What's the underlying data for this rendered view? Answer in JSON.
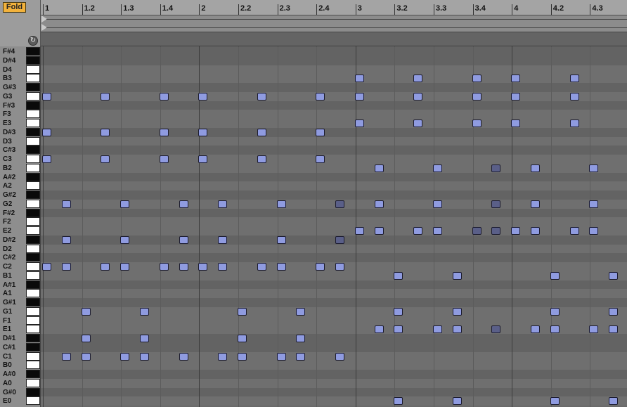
{
  "toolbar": {
    "fold_label": "Fold",
    "reset_icon": "refresh-icon"
  },
  "ruler": {
    "labels": [
      "1",
      "1.2",
      "1.3",
      "1.4",
      "2",
      "2.2",
      "2.3",
      "2.4",
      "3",
      "3.2",
      "3.3",
      "3.4",
      "4",
      "4.2",
      "4.3"
    ]
  },
  "piano": {
    "rows": [
      {
        "label": "F#4",
        "black": true
      },
      {
        "label": "D#4",
        "black": true
      },
      {
        "label": "D4",
        "black": false
      },
      {
        "label": "B3",
        "black": false
      },
      {
        "label": "G#3",
        "black": true
      },
      {
        "label": "G3",
        "black": false
      },
      {
        "label": "F#3",
        "black": true
      },
      {
        "label": "F3",
        "black": false
      },
      {
        "label": "E3",
        "black": false
      },
      {
        "label": "D#3",
        "black": true
      },
      {
        "label": "D3",
        "black": false
      },
      {
        "label": "C#3",
        "black": true
      },
      {
        "label": "C3",
        "black": false
      },
      {
        "label": "B2",
        "black": false
      },
      {
        "label": "A#2",
        "black": true
      },
      {
        "label": "A2",
        "black": false
      },
      {
        "label": "G#2",
        "black": true
      },
      {
        "label": "G2",
        "black": false
      },
      {
        "label": "F#2",
        "black": true
      },
      {
        "label": "F2",
        "black": false
      },
      {
        "label": "E2",
        "black": false
      },
      {
        "label": "D#2",
        "black": true
      },
      {
        "label": "D2",
        "black": false
      },
      {
        "label": "C#2",
        "black": true
      },
      {
        "label": "C2",
        "black": false
      },
      {
        "label": "B1",
        "black": false
      },
      {
        "label": "A#1",
        "black": true
      },
      {
        "label": "A1",
        "black": false
      },
      {
        "label": "G#1",
        "black": true
      },
      {
        "label": "G1",
        "black": false
      },
      {
        "label": "F1",
        "black": false
      },
      {
        "label": "E1",
        "black": false
      },
      {
        "label": "D#1",
        "black": true
      },
      {
        "label": "C#1",
        "black": true
      },
      {
        "label": "C1",
        "black": false
      },
      {
        "label": "B0",
        "black": false
      },
      {
        "label": "A#0",
        "black": true
      },
      {
        "label": "A0",
        "black": false
      },
      {
        "label": "G#0",
        "black": true
      },
      {
        "label": "E0",
        "black": false
      }
    ]
  },
  "clip": {
    "colors": {
      "selected": "#8f9be0",
      "unselected": "#5a5f88",
      "border": "#1c1c30"
    },
    "notes": [
      {
        "pitch": "G3",
        "start": 1.0,
        "sel": true
      },
      {
        "pitch": "D#3",
        "start": 1.0,
        "sel": true
      },
      {
        "pitch": "C3",
        "start": 1.0,
        "sel": true
      },
      {
        "pitch": "G3",
        "start": 1.375,
        "sel": true
      },
      {
        "pitch": "D#3",
        "start": 1.375,
        "sel": true
      },
      {
        "pitch": "C3",
        "start": 1.375,
        "sel": true
      },
      {
        "pitch": "G3",
        "start": 1.75,
        "sel": true
      },
      {
        "pitch": "D#3",
        "start": 1.75,
        "sel": true
      },
      {
        "pitch": "C3",
        "start": 1.75,
        "sel": true
      },
      {
        "pitch": "G3",
        "start": 2.0,
        "sel": true
      },
      {
        "pitch": "D#3",
        "start": 2.0,
        "sel": true
      },
      {
        "pitch": "C3",
        "start": 2.0,
        "sel": true
      },
      {
        "pitch": "G3",
        "start": 2.375,
        "sel": true
      },
      {
        "pitch": "D#3",
        "start": 2.375,
        "sel": true
      },
      {
        "pitch": "C3",
        "start": 2.375,
        "sel": true
      },
      {
        "pitch": "G3",
        "start": 2.75,
        "sel": true
      },
      {
        "pitch": "D#3",
        "start": 2.75,
        "sel": true
      },
      {
        "pitch": "C3",
        "start": 2.75,
        "sel": true
      },
      {
        "pitch": "G2",
        "start": 1.125,
        "sel": true
      },
      {
        "pitch": "D#2",
        "start": 1.125,
        "sel": true
      },
      {
        "pitch": "G2",
        "start": 1.5,
        "sel": true
      },
      {
        "pitch": "D#2",
        "start": 1.5,
        "sel": true
      },
      {
        "pitch": "G2",
        "start": 1.875,
        "sel": true
      },
      {
        "pitch": "D#2",
        "start": 1.875,
        "sel": true
      },
      {
        "pitch": "G2",
        "start": 2.125,
        "sel": true
      },
      {
        "pitch": "D#2",
        "start": 2.125,
        "sel": true
      },
      {
        "pitch": "G2",
        "start": 2.5,
        "sel": true
      },
      {
        "pitch": "D#2",
        "start": 2.5,
        "sel": true
      },
      {
        "pitch": "G2",
        "start": 2.875,
        "sel": false
      },
      {
        "pitch": "D#2",
        "start": 2.875,
        "sel": false
      },
      {
        "pitch": "C2",
        "start": 1.0,
        "sel": true
      },
      {
        "pitch": "C2",
        "start": 1.125,
        "sel": true
      },
      {
        "pitch": "C2",
        "start": 1.375,
        "sel": true
      },
      {
        "pitch": "C2",
        "start": 1.5,
        "sel": true
      },
      {
        "pitch": "C2",
        "start": 1.75,
        "sel": true
      },
      {
        "pitch": "C2",
        "start": 1.875,
        "sel": true
      },
      {
        "pitch": "C2",
        "start": 2.0,
        "sel": true
      },
      {
        "pitch": "C2",
        "start": 2.125,
        "sel": true
      },
      {
        "pitch": "C2",
        "start": 2.375,
        "sel": true
      },
      {
        "pitch": "C2",
        "start": 2.5,
        "sel": true
      },
      {
        "pitch": "C2",
        "start": 2.75,
        "sel": true
      },
      {
        "pitch": "C2",
        "start": 2.875,
        "sel": true
      },
      {
        "pitch": "G1",
        "start": 1.25,
        "sel": true
      },
      {
        "pitch": "D#1",
        "start": 1.25,
        "sel": true
      },
      {
        "pitch": "G1",
        "start": 1.625,
        "sel": true
      },
      {
        "pitch": "D#1",
        "start": 1.625,
        "sel": true
      },
      {
        "pitch": "G1",
        "start": 2.25,
        "sel": true
      },
      {
        "pitch": "D#1",
        "start": 2.25,
        "sel": true
      },
      {
        "pitch": "G1",
        "start": 2.625,
        "sel": true
      },
      {
        "pitch": "D#1",
        "start": 2.625,
        "sel": true
      },
      {
        "pitch": "C1",
        "start": 1.125,
        "sel": true
      },
      {
        "pitch": "C1",
        "start": 1.25,
        "sel": true
      },
      {
        "pitch": "C1",
        "start": 1.5,
        "sel": true
      },
      {
        "pitch": "C1",
        "start": 1.625,
        "sel": true
      },
      {
        "pitch": "C1",
        "start": 1.875,
        "sel": true
      },
      {
        "pitch": "C1",
        "start": 2.125,
        "sel": true
      },
      {
        "pitch": "C1",
        "start": 2.25,
        "sel": true
      },
      {
        "pitch": "C1",
        "start": 2.5,
        "sel": true
      },
      {
        "pitch": "C1",
        "start": 2.625,
        "sel": true
      },
      {
        "pitch": "C1",
        "start": 2.875,
        "sel": true
      },
      {
        "pitch": "B3",
        "start": 3.0,
        "sel": true
      },
      {
        "pitch": "G3",
        "start": 3.0,
        "sel": true
      },
      {
        "pitch": "E3",
        "start": 3.0,
        "sel": true
      },
      {
        "pitch": "B3",
        "start": 3.375,
        "sel": true
      },
      {
        "pitch": "G3",
        "start": 3.375,
        "sel": true
      },
      {
        "pitch": "E3",
        "start": 3.375,
        "sel": true
      },
      {
        "pitch": "B3",
        "start": 3.75,
        "sel": true
      },
      {
        "pitch": "G3",
        "start": 3.75,
        "sel": true
      },
      {
        "pitch": "E3",
        "start": 3.75,
        "sel": true
      },
      {
        "pitch": "B3",
        "start": 4.0,
        "sel": true
      },
      {
        "pitch": "G3",
        "start": 4.0,
        "sel": true
      },
      {
        "pitch": "E3",
        "start": 4.0,
        "sel": true
      },
      {
        "pitch": "B3",
        "start": 4.375,
        "sel": true
      },
      {
        "pitch": "G3",
        "start": 4.375,
        "sel": true
      },
      {
        "pitch": "E3",
        "start": 4.375,
        "sel": true
      },
      {
        "pitch": "B2",
        "start": 3.125,
        "sel": true
      },
      {
        "pitch": "G2",
        "start": 3.125,
        "sel": true
      },
      {
        "pitch": "B2",
        "start": 3.5,
        "sel": true
      },
      {
        "pitch": "G2",
        "start": 3.5,
        "sel": true
      },
      {
        "pitch": "B2",
        "start": 3.875,
        "sel": false
      },
      {
        "pitch": "G2",
        "start": 3.875,
        "sel": false
      },
      {
        "pitch": "B2",
        "start": 4.125,
        "sel": true
      },
      {
        "pitch": "G2",
        "start": 4.125,
        "sel": true
      },
      {
        "pitch": "B2",
        "start": 4.5,
        "sel": true
      },
      {
        "pitch": "G2",
        "start": 4.5,
        "sel": true
      },
      {
        "pitch": "E2",
        "start": 3.0,
        "sel": true
      },
      {
        "pitch": "E2",
        "start": 3.125,
        "sel": true
      },
      {
        "pitch": "E2",
        "start": 3.375,
        "sel": true
      },
      {
        "pitch": "E2",
        "start": 3.5,
        "sel": true
      },
      {
        "pitch": "E2",
        "start": 3.75,
        "sel": false
      },
      {
        "pitch": "E2",
        "start": 3.875,
        "sel": false
      },
      {
        "pitch": "E2",
        "start": 4.0,
        "sel": true
      },
      {
        "pitch": "E2",
        "start": 4.125,
        "sel": true
      },
      {
        "pitch": "E2",
        "start": 4.375,
        "sel": true
      },
      {
        "pitch": "E2",
        "start": 4.5,
        "sel": true
      },
      {
        "pitch": "B1",
        "start": 3.25,
        "sel": true
      },
      {
        "pitch": "G1",
        "start": 3.25,
        "sel": true
      },
      {
        "pitch": "B1",
        "start": 3.625,
        "sel": true
      },
      {
        "pitch": "G1",
        "start": 3.625,
        "sel": true
      },
      {
        "pitch": "B1",
        "start": 4.25,
        "sel": true
      },
      {
        "pitch": "G1",
        "start": 4.25,
        "sel": true
      },
      {
        "pitch": "B1",
        "start": 4.625,
        "sel": true
      },
      {
        "pitch": "G1",
        "start": 4.625,
        "sel": true
      },
      {
        "pitch": "E1",
        "start": 3.125,
        "sel": true
      },
      {
        "pitch": "E1",
        "start": 3.25,
        "sel": true
      },
      {
        "pitch": "E1",
        "start": 3.5,
        "sel": true
      },
      {
        "pitch": "E1",
        "start": 3.625,
        "sel": true
      },
      {
        "pitch": "E1",
        "start": 3.875,
        "sel": false
      },
      {
        "pitch": "E1",
        "start": 4.125,
        "sel": true
      },
      {
        "pitch": "E1",
        "start": 4.25,
        "sel": true
      },
      {
        "pitch": "E1",
        "start": 4.5,
        "sel": true
      },
      {
        "pitch": "E1",
        "start": 4.625,
        "sel": true
      },
      {
        "pitch": "E0",
        "start": 3.25,
        "sel": true
      },
      {
        "pitch": "E0",
        "start": 3.625,
        "sel": true
      },
      {
        "pitch": "E0",
        "start": 4.25,
        "sel": true
      },
      {
        "pitch": "E0",
        "start": 4.625,
        "sel": true
      }
    ]
  }
}
